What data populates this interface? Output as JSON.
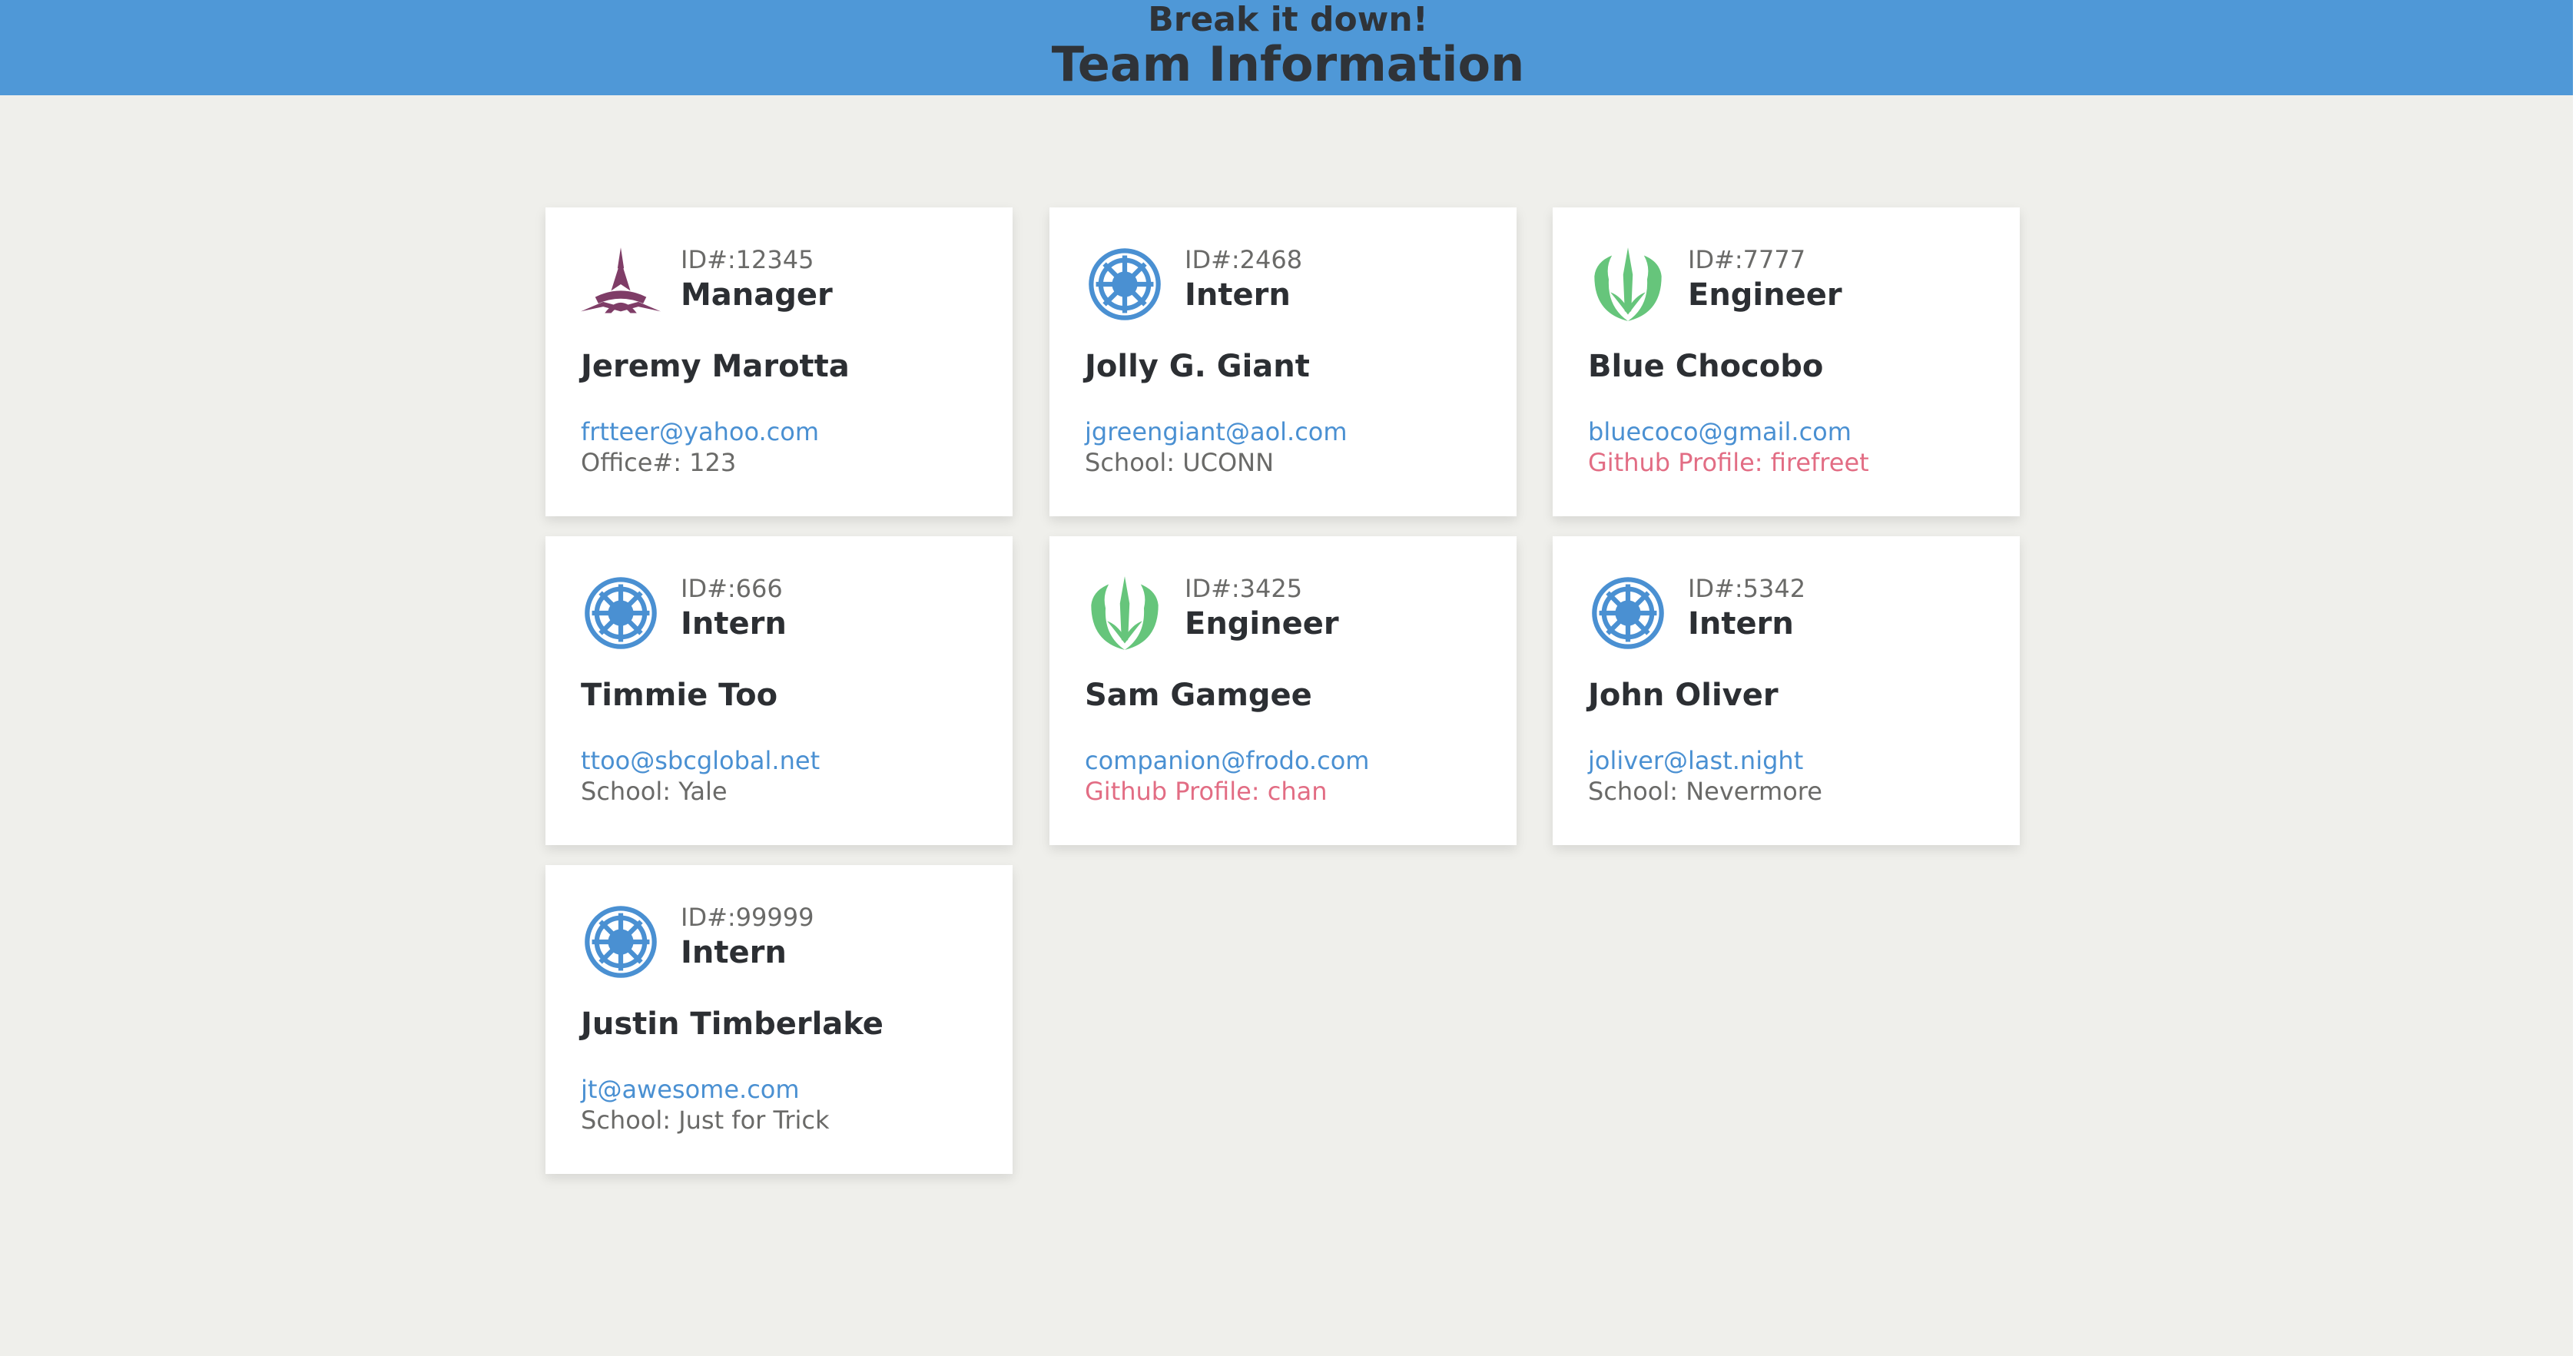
{
  "header": {
    "subtitle": "Break it down!",
    "title": "Team Information"
  },
  "colors": {
    "header_bg": "#4f98d7",
    "page_bg": "#efefeb",
    "link_blue": "#4a90d2",
    "github_pink": "#e26d84",
    "manager_icon": "#7f3d67",
    "intern_icon": "#4a90d2",
    "engineer_icon": "#66c57b"
  },
  "cards": [
    {
      "id": "ID#:12345",
      "role": "Manager",
      "name": "Jeremy Marotta",
      "email": "frtteer@yahoo.com",
      "extra": "Office#: 123",
      "icon": "manager-emblem-icon"
    },
    {
      "id": "ID#:2468",
      "role": "Intern",
      "name": "Jolly G. Giant",
      "email": "jgreengiant@aol.com",
      "extra": "School: UCONN",
      "icon": "intern-emblem-icon"
    },
    {
      "id": "ID#:7777",
      "role": "Engineer",
      "name": "Blue Chocobo",
      "email": "bluecoco@gmail.com",
      "extra": "Github Profile: firefreet",
      "icon": "engineer-emblem-icon"
    },
    {
      "id": "ID#:666",
      "role": "Intern",
      "name": "Timmie Too",
      "email": "ttoo@sbcglobal.net",
      "extra": "School: Yale",
      "icon": "intern-emblem-icon"
    },
    {
      "id": "ID#:3425",
      "role": "Engineer",
      "name": "Sam Gamgee",
      "email": "companion@frodo.com",
      "extra": "Github Profile: chan",
      "icon": "engineer-emblem-icon"
    },
    {
      "id": "ID#:5342",
      "role": "Intern",
      "name": "John Oliver",
      "email": "joliver@last.night",
      "extra": "School: Nevermore",
      "icon": "intern-emblem-icon"
    },
    {
      "id": "ID#:99999",
      "role": "Intern",
      "name": "Justin Timberlake",
      "email": "jt@awesome.com",
      "extra": "School: Just for Trick",
      "icon": "intern-emblem-icon"
    }
  ]
}
